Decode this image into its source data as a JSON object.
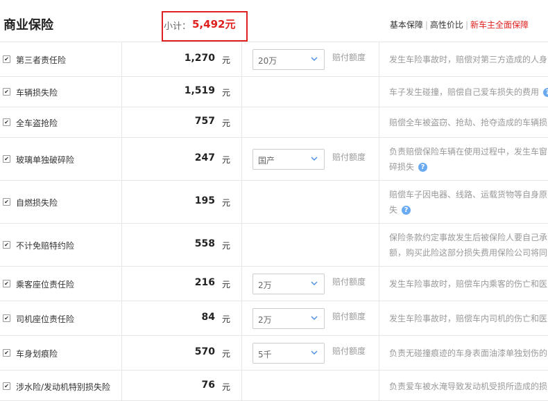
{
  "header": {
    "title": "商业保险",
    "subtotal_label": "小计：",
    "subtotal_value": "5,492元",
    "plans": [
      "基本保障",
      "高性价比",
      "新车主全面保障"
    ],
    "active_plan_index": 2
  },
  "colors": {
    "accent": "#e0201f",
    "help": "#6aaaf0"
  },
  "rows": [
    {
      "name": "第三者责任险",
      "price": "1,270",
      "unit": "元",
      "select": "20万",
      "opt_label": "赔付额度",
      "desc1": "发生车险事故时，赔偿对第三方造成的人身",
      "desc2": "",
      "help": false
    },
    {
      "name": "车辆损失险",
      "price": "1,519",
      "unit": "元",
      "select": "",
      "opt_label": "",
      "desc1": "车子发生碰撞，赔偿自己爱车损失的费用",
      "desc2": "",
      "help": true
    },
    {
      "name": "全车盗抢险",
      "price": "757",
      "unit": "元",
      "select": "",
      "opt_label": "",
      "desc1": "赔偿全车被盗窃、抢劫、抢夺造成的车辆损",
      "desc2": "",
      "help": false
    },
    {
      "name": "玻璃单独破碎险",
      "price": "247",
      "unit": "元",
      "select": "国产",
      "opt_label": "赔付额度",
      "desc1": "负责赔偿保险车辆在使用过程中，发生车窗",
      "desc2": "碎损失",
      "help": true
    },
    {
      "name": "自燃损失险",
      "price": "195",
      "unit": "元",
      "select": "",
      "opt_label": "",
      "desc1": "赔偿车子因电器、线路、运载货物等自身原",
      "desc2": "失",
      "help": true
    },
    {
      "name": "不计免赔特约险",
      "price": "558",
      "unit": "元",
      "select": "",
      "opt_label": "",
      "desc1": "保险条款约定事故发生后被保险人要自己承",
      "desc2": "额，购买此险这部分损失费用保险公司将同",
      "help": false
    },
    {
      "name": "乘客座位责任险",
      "price": "216",
      "unit": "元",
      "select": "2万",
      "opt_label": "赔付额度",
      "desc1": "发生车险事故时，赔偿车内乘客的伤亡和医",
      "desc2": "",
      "help": false
    },
    {
      "name": "司机座位责任险",
      "price": "84",
      "unit": "元",
      "select": "2万",
      "opt_label": "赔付额度",
      "desc1": "发生车险事故时，赔偿车内司机的伤亡和医",
      "desc2": "",
      "help": false
    },
    {
      "name": "车身划痕险",
      "price": "570",
      "unit": "元",
      "select": "5千",
      "opt_label": "赔付额度",
      "desc1": "负责无碰撞痕迹的车身表面油漆单独划伤的",
      "desc2": "",
      "help": false
    },
    {
      "name": "涉水险/发动机特别损失险",
      "price": "76",
      "unit": "元",
      "select": "",
      "opt_label": "",
      "desc1": "负责爱车被水淹导致发动机受损所造成的损",
      "desc2": "",
      "help": false
    }
  ]
}
